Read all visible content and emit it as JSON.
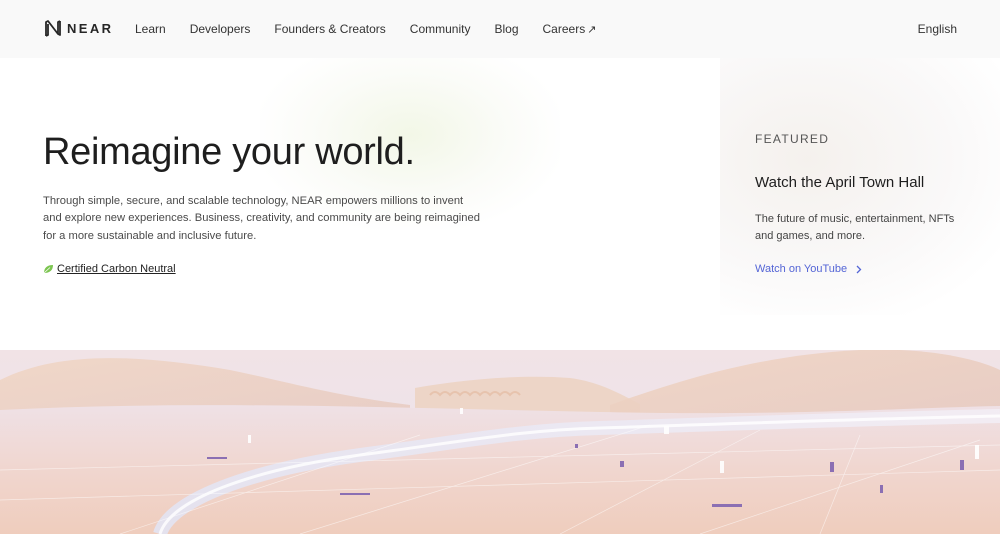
{
  "brand": {
    "name": "NEAR",
    "logo_icon": "near-logo-icon"
  },
  "nav": {
    "links": [
      {
        "label": "Learn"
      },
      {
        "label": "Developers"
      },
      {
        "label": "Founders & Creators"
      },
      {
        "label": "Community"
      },
      {
        "label": "Blog"
      },
      {
        "label": "Careers",
        "external_icon": "↗"
      }
    ],
    "language": "English"
  },
  "hero": {
    "title": "Reimagine your world.",
    "description": "Through simple, secure, and scalable technology, NEAR empowers millions to invent and explore new experiences. Business, creativity, and community are being reimagined for a more sustainable and inclusive future.",
    "badge": {
      "label": "Certified Carbon Neutral",
      "icon": "leaf-icon",
      "icon_color": "#7cc551"
    }
  },
  "featured": {
    "label": "FEATURED",
    "title": "Watch the April Town Hall",
    "description": "The future of music, entertainment, NFTs and games, and more.",
    "link_label": "Watch on YouTube",
    "link_icon": "chevron-right-icon",
    "link_color": "#5465d6"
  },
  "colors": {
    "nav_bg": "#f9f9f9",
    "text": "#262626",
    "landscape_sand": "#f1d2c4",
    "landscape_sky": "#ece4ec"
  }
}
